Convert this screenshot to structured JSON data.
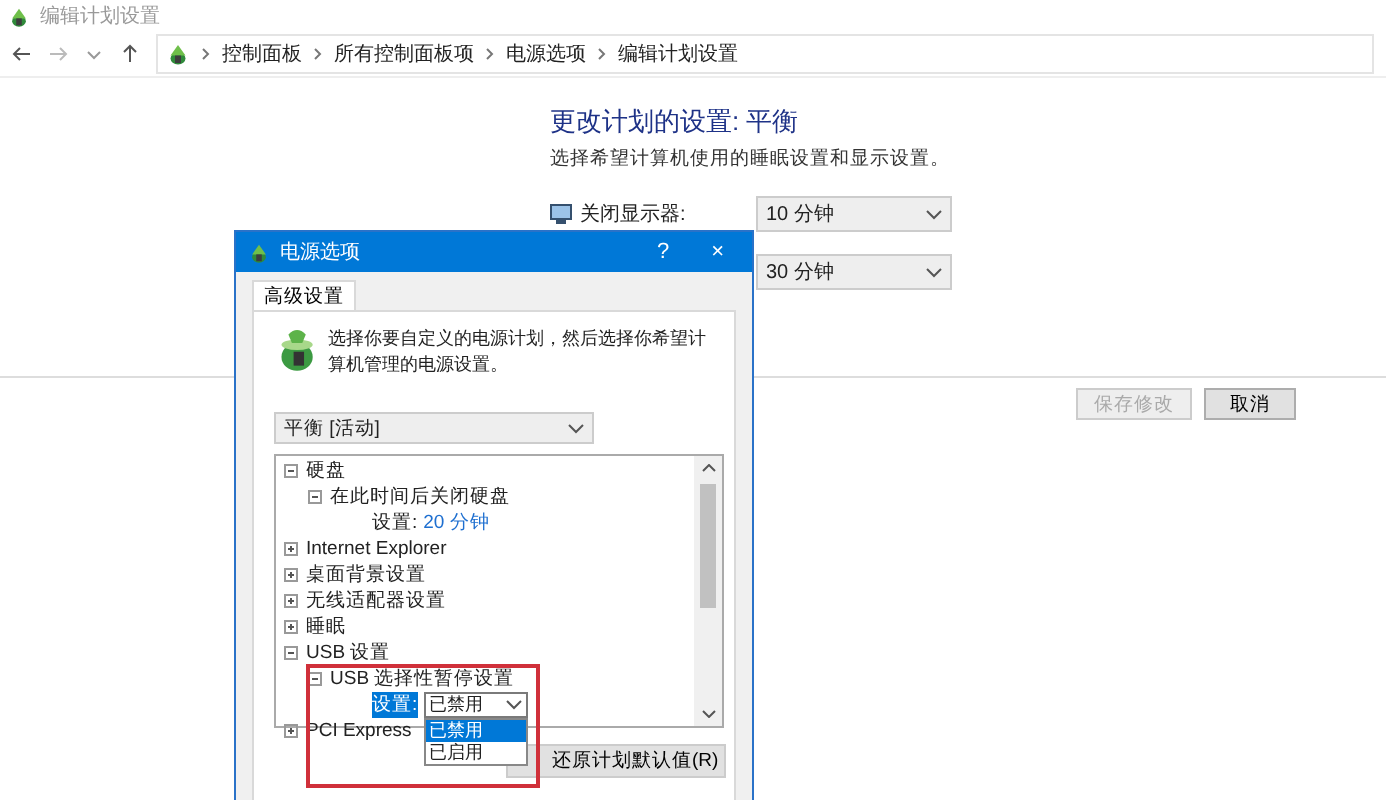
{
  "window": {
    "title": "编辑计划设置"
  },
  "address_bar": {
    "crumbs": [
      "控制面板",
      "所有控制面板项",
      "电源选项",
      "编辑计划设置"
    ]
  },
  "page": {
    "heading": "更改计划的设置: 平衡",
    "subtitle": "选择希望计算机使用的睡眠设置和显示设置。",
    "settings": [
      {
        "label": "关闭显示器:",
        "value": "10 分钟"
      },
      {
        "value": "30 分钟"
      }
    ],
    "buttons": [
      {
        "label": "保存修改",
        "disabled": true
      },
      {
        "label": "取消",
        "disabled": false
      }
    ]
  },
  "dialog": {
    "title": "电源选项",
    "help": "?",
    "close": "×",
    "tabs": [
      {
        "label": "高级设置",
        "selected": true
      }
    ],
    "description": "选择你要自定义的电源计划，然后选择你希望计算机管理的电源设置。",
    "plan": {
      "value": "平衡 [活动]"
    },
    "highlight_frame": true,
    "tree": [
      {
        "kind": "group",
        "label": "硬盘",
        "expanded": true,
        "children": [
          {
            "kind": "group",
            "label": "在此时间后关闭硬盘",
            "expanded": true,
            "children": [
              {
                "kind": "setting",
                "label": "设置:",
                "value": "20 分钟"
              }
            ]
          }
        ]
      },
      {
        "kind": "group",
        "label": "Internet Explorer",
        "expanded": false
      },
      {
        "kind": "group",
        "label": "桌面背景设置",
        "expanded": false
      },
      {
        "kind": "group",
        "label": "无线适配器设置",
        "expanded": false
      },
      {
        "kind": "group",
        "label": "睡眠",
        "expanded": false
      },
      {
        "kind": "group",
        "label": "USB 设置",
        "expanded": true,
        "children": [
          {
            "kind": "group",
            "label": "USB 选择性暂停设置",
            "expanded": true,
            "children": [
              {
                "kind": "select",
                "label": "设置:",
                "value": "已禁用",
                "selected": true,
                "open": true,
                "options": [
                  {
                    "label": "已禁用",
                    "selected": true
                  },
                  {
                    "label": "已启用",
                    "selected": false
                  }
                ]
              }
            ]
          }
        ]
      },
      {
        "kind": "group",
        "label": "PCI Express",
        "expanded": false
      }
    ],
    "restore_button": "还原计划默认值(R)"
  }
}
